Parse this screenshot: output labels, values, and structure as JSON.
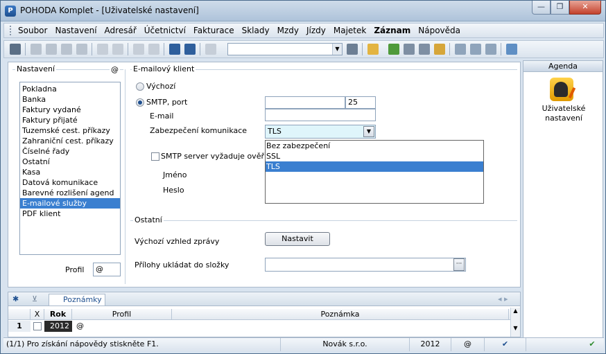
{
  "window": {
    "title": "POHODA Komplet - [Uživatelské nastavení]",
    "app_icon_glyph": "P",
    "minimize_glyph": "—",
    "maximize_glyph": "❐",
    "close_glyph": "✕"
  },
  "menu": {
    "items": [
      "Soubor",
      "Nastavení",
      "Adresář",
      "Účetnictví",
      "Fakturace",
      "Sklady",
      "Mzdy",
      "Jízdy",
      "Majetek",
      "Záznam",
      "Nápověda"
    ],
    "bold_item": "Záznam"
  },
  "toolbar": {
    "combo_value": "",
    "combo_arrow": "▼"
  },
  "settings": {
    "group_label": "Nastavení",
    "at_label": "@",
    "items": [
      "Pokladna",
      "Banka",
      "Faktury vydané",
      "Faktury přijaté",
      "Tuzemské cest. příkazy",
      "Zahraniční cest. příkazy",
      "Číselné řady",
      "Ostatní",
      "Kasa",
      "Datová komunikace",
      "Barevné rozlišení agend",
      "E-mailové služby",
      "PDF klient"
    ],
    "selected": "E-mailové služby",
    "profil_label": "Profil",
    "profil_value": "@"
  },
  "email_client": {
    "group_label": "E-mailový klient",
    "default_label": "Výchozí",
    "smtp_label": "SMTP, port",
    "smtp_selected": true,
    "smtp_host": "",
    "port": "25",
    "email_label": "E-mail",
    "security_label": "Zabezpečení komunikace",
    "security_value": "TLS",
    "security_options": [
      "Bez zabezpečení",
      "SSL",
      "TLS"
    ],
    "auth_label": "SMTP server vyžaduje ověř",
    "name_label": "Jméno",
    "password_label": "Heslo",
    "arrow": "▼"
  },
  "other": {
    "group_label": "Ostatní",
    "view_label": "Výchozí vzhled zprávy",
    "set_button": "Nastavit",
    "attach_label": "Přílohy ukládat do složky",
    "attach_value": "",
    "ellipsis": "···"
  },
  "agenda": {
    "header": "Agenda",
    "item_label": "Uživatelské nastavení"
  },
  "grid": {
    "tab_star": "✱",
    "tab_filter_glyph": "⊻",
    "tab_notes": "Poznámky",
    "nav_glyphs": "◂ ▸",
    "columns": [
      "X",
      "Rok",
      "Profil",
      "Poznámka"
    ],
    "rows": [
      {
        "num": "1",
        "rok": "2012",
        "profil": "@",
        "poznamka": ""
      }
    ],
    "scroll_up": "▲",
    "scroll_down": "▼"
  },
  "statusbar": {
    "help": "(1/1) Pro získání nápovědy stiskněte F1.",
    "company": "Novák s.r.o.",
    "year": "2012",
    "at": "@",
    "check_glyph": "✔",
    "ok_glyph": "✔"
  },
  "colors": {
    "selection": "#3a7fd0",
    "titlebar": "#cfdcea",
    "close": "#c3412c"
  }
}
